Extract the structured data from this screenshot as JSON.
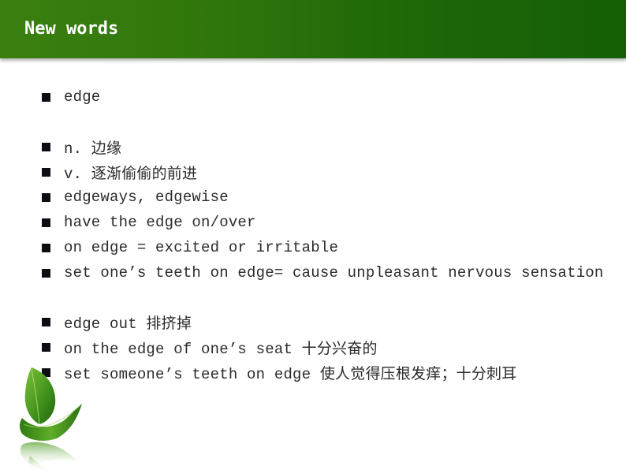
{
  "header": {
    "title": "New words"
  },
  "items": [
    {
      "text": "edge"
    },
    {
      "text": "n. 边缘"
    },
    {
      "text": "v. 逐渐偷偷的前进"
    },
    {
      "text": "edgeways, edgewise"
    },
    {
      "text": "have the edge on/over"
    },
    {
      "text": "on edge = excited or irritable"
    },
    {
      "text": "set one’s teeth on edge= cause unpleasant nervous sensation"
    },
    {
      "text": "edge out 排挤掉"
    },
    {
      "text": "on the edge of one’s seat 十分兴奋的"
    },
    {
      "text": "set someone’s teeth on edge 使人觉得压根发痒；十分刺耳"
    }
  ],
  "decoration": {
    "icon": "leaf-icon"
  },
  "colors": {
    "header_start": "#3b7f10",
    "header_end": "#155f06",
    "title_text": "#ffffff",
    "body_text": "#2b2b2b",
    "bullet": "#0d0d14"
  }
}
